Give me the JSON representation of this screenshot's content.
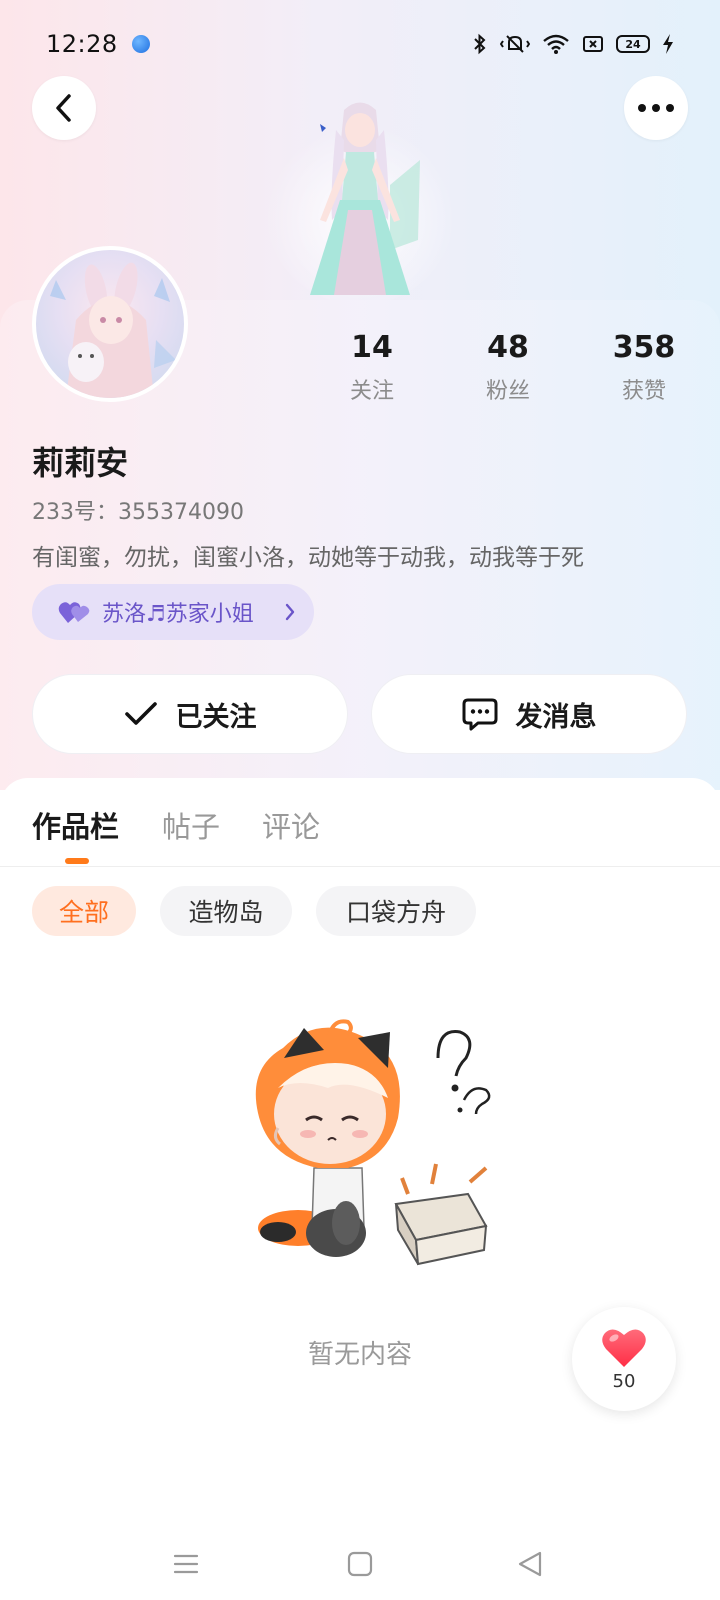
{
  "status_bar": {
    "time": "12:28",
    "battery": "24",
    "icons": [
      "app-notification-icon",
      "bluetooth-icon",
      "vibrate-icon",
      "wifi-icon",
      "screen-record-icon",
      "battery-icon",
      "charging-icon"
    ]
  },
  "header": {
    "back_icon": "chevron-left-icon",
    "more_icon": "ellipsis-icon"
  },
  "profile": {
    "stats": [
      {
        "value": "14",
        "label": "关注"
      },
      {
        "value": "48",
        "label": "粉丝"
      },
      {
        "value": "358",
        "label": "获赞"
      }
    ],
    "name": "莉莉安",
    "id_text": "233号：355374090",
    "bio": "有闺蜜，勿扰，闺蜜小洛，动她等于动我，动我等于死",
    "relation_tag": "苏洛♬苏家小姐"
  },
  "actions": {
    "follow_label": "已关注",
    "message_label": "发消息"
  },
  "tabs": [
    "作品栏",
    "帖子",
    "评论"
  ],
  "chips": [
    "全部",
    "造物岛",
    "口袋方舟"
  ],
  "empty_text": "暂无内容",
  "like_fab": {
    "count": "50"
  },
  "colors": {
    "accent": "#ff7a1a",
    "tag_bg": "#e6e0f8",
    "tag_text": "#6a55c9",
    "like_red": "#ff3b4e"
  }
}
